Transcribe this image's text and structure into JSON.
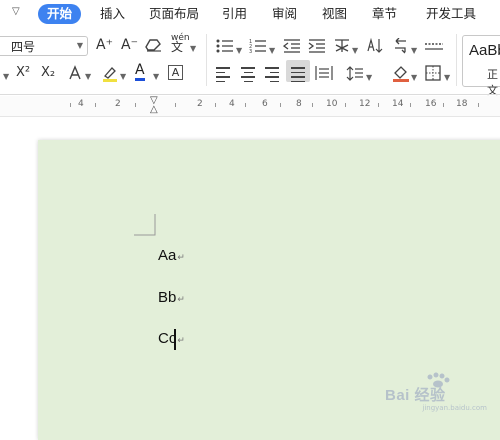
{
  "tabs": [
    "开始",
    "插入",
    "页面布局",
    "引用",
    "审阅",
    "视图",
    "章节",
    "开发工具"
  ],
  "ribbon": {
    "font_size": "四号",
    "grow_font": "A⁺",
    "shrink_font": "A⁻",
    "superscript": "X²",
    "subscript": "X₂",
    "font_color_letter": "A",
    "char_border_letter": "A",
    "phonetic_label": "wén",
    "style_preview": "AaBbC",
    "style_name": "正文"
  },
  "ruler": {
    "labels": [
      "4",
      "2",
      "2",
      "4",
      "6",
      "8",
      "10",
      "12",
      "14",
      "16",
      "18"
    ]
  },
  "document": {
    "paragraphs": [
      "Aa",
      "Bb",
      "Cc"
    ],
    "paragraph_mark": "↵"
  },
  "watermark": {
    "text": "Bai 经验",
    "sub": "jingyan.baidu.com"
  },
  "colors": {
    "accent": "#3d82f0",
    "page_background": "#e3efd9",
    "font_color_underline": "#1c4fd9",
    "highlight_underline": "#f0e040",
    "shading_underline": "#e06040"
  }
}
